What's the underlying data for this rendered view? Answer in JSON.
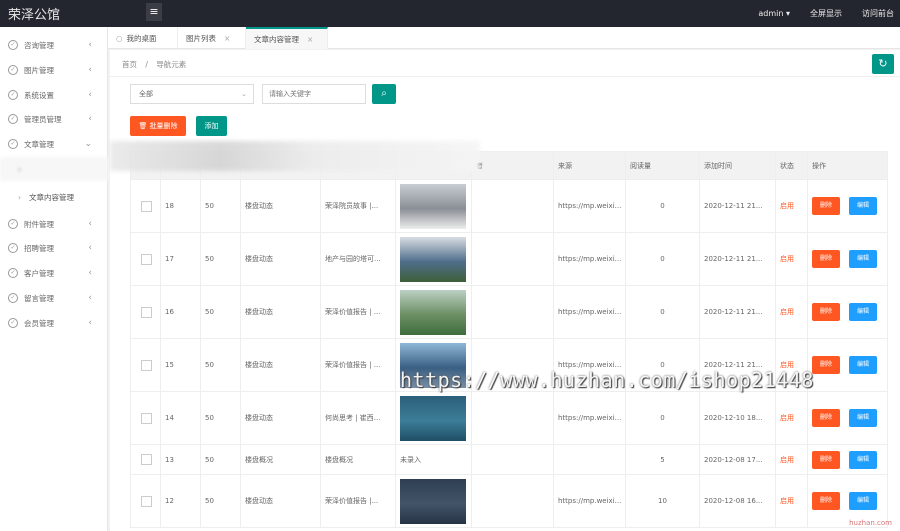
{
  "app": {
    "title": "荣泽公馆",
    "menu_icon": "hamburger-icon"
  },
  "topbar": {
    "user": "admin",
    "fullscreen": "全屏显示",
    "visit_site": "访问前台"
  },
  "sidebar": {
    "items": [
      {
        "label": "咨询管理",
        "icon": "circle-check-icon"
      },
      {
        "label": "图片管理",
        "icon": "circle-check-icon"
      },
      {
        "label": "系统设置",
        "icon": "circle-check-icon"
      },
      {
        "label": "管理员管理",
        "icon": "circle-check-icon"
      },
      {
        "label": "文章管理",
        "icon": "circle-check-icon"
      },
      {
        "label": "文章内容管理",
        "icon": "chevron-right-icon"
      },
      {
        "label": "附件管理",
        "icon": "circle-check-icon"
      },
      {
        "label": "招聘管理",
        "icon": "circle-check-icon"
      },
      {
        "label": "客户管理",
        "icon": "circle-check-icon"
      },
      {
        "label": "留言管理",
        "icon": "circle-check-icon"
      },
      {
        "label": "会员管理",
        "icon": "circle-check-icon"
      }
    ]
  },
  "tabs": [
    {
      "label": "我的桌面"
    },
    {
      "label": "图片列表"
    },
    {
      "label": "文章内容管理"
    }
  ],
  "breadcrumb": {
    "home": "首页",
    "sep": "/",
    "current": "导航元素"
  },
  "filter": {
    "select_value": "全部",
    "keyword_placeholder": "请输入关键字"
  },
  "actions": {
    "batch_delete": "批量删除",
    "add": "添加"
  },
  "table": {
    "columns": [
      "",
      "",
      "",
      "",
      "",
      "",
      "者",
      "来源",
      "阅读量",
      "添加时间",
      "状态",
      "操作"
    ],
    "rows": [
      {
        "id": "18",
        "sort": "50",
        "category": "楼盘动态",
        "title": "荣泽院员故事 |...",
        "has_image": true,
        "source": "https://mp.weixi...",
        "views": "0",
        "time": "2020-12-11 21...",
        "status": "启用",
        "img_colors": [
          "#c8cdd2",
          "#8a8f96",
          "#ededed"
        ]
      },
      {
        "id": "17",
        "sort": "50",
        "category": "楼盘动态",
        "title": "地产与园的塔可...",
        "has_image": true,
        "source": "https://mp.weixi...",
        "views": "0",
        "time": "2020-12-11 21...",
        "status": "启用",
        "img_colors": [
          "#d9dde2",
          "#4f6e8a",
          "#3f5f3a"
        ]
      },
      {
        "id": "16",
        "sort": "50",
        "category": "楼盘动态",
        "title": "荣泽价值报告 | ...",
        "has_image": true,
        "source": "https://mp.weixi...",
        "views": "0",
        "time": "2020-12-11 21...",
        "status": "启用",
        "img_colors": [
          "#bcd0c4",
          "#6b8f63",
          "#3f6e3d"
        ]
      },
      {
        "id": "15",
        "sort": "50",
        "category": "楼盘动态",
        "title": "荣泽价值报告 | ...",
        "has_image": true,
        "source": "https://mp.weixi...",
        "views": "0",
        "time": "2020-12-11 21...",
        "status": "启用",
        "img_colors": [
          "#8fb7d8",
          "#3a5f82",
          "#7a8fa6"
        ]
      },
      {
        "id": "14",
        "sort": "50",
        "category": "楼盘动态",
        "title": "何尚思考 | 崔西...",
        "has_image": true,
        "source": "https://mp.weixi...",
        "views": "0",
        "time": "2020-12-10 18...",
        "status": "启用",
        "img_colors": [
          "#2b5f7a",
          "#3c7d97",
          "#1f4f66"
        ]
      },
      {
        "id": "13",
        "sort": "50",
        "category": "楼盘概况",
        "title": "楼盘概况",
        "image_text": "未录入",
        "has_image": false,
        "source": "",
        "views": "5",
        "time": "2020-12-08 17...",
        "status": "启用"
      },
      {
        "id": "12",
        "sort": "50",
        "category": "楼盘动态",
        "title": "荣泽价值报告 |...",
        "has_image": true,
        "source": "https://mp.weixi...",
        "views": "10",
        "time": "2020-12-08 16...",
        "status": "启用",
        "img_colors": [
          "#2f3e52",
          "#435468",
          "#263445"
        ]
      }
    ],
    "delete_label": "删除",
    "edit_label": "编辑"
  },
  "watermark": {
    "text": "https://www.huzhan.com/ishop21448",
    "corner": "huzhan.com"
  },
  "colors": {
    "primary": "#009688",
    "danger": "#ff5722",
    "info": "#1e9fff",
    "topbar": "#23262e"
  }
}
